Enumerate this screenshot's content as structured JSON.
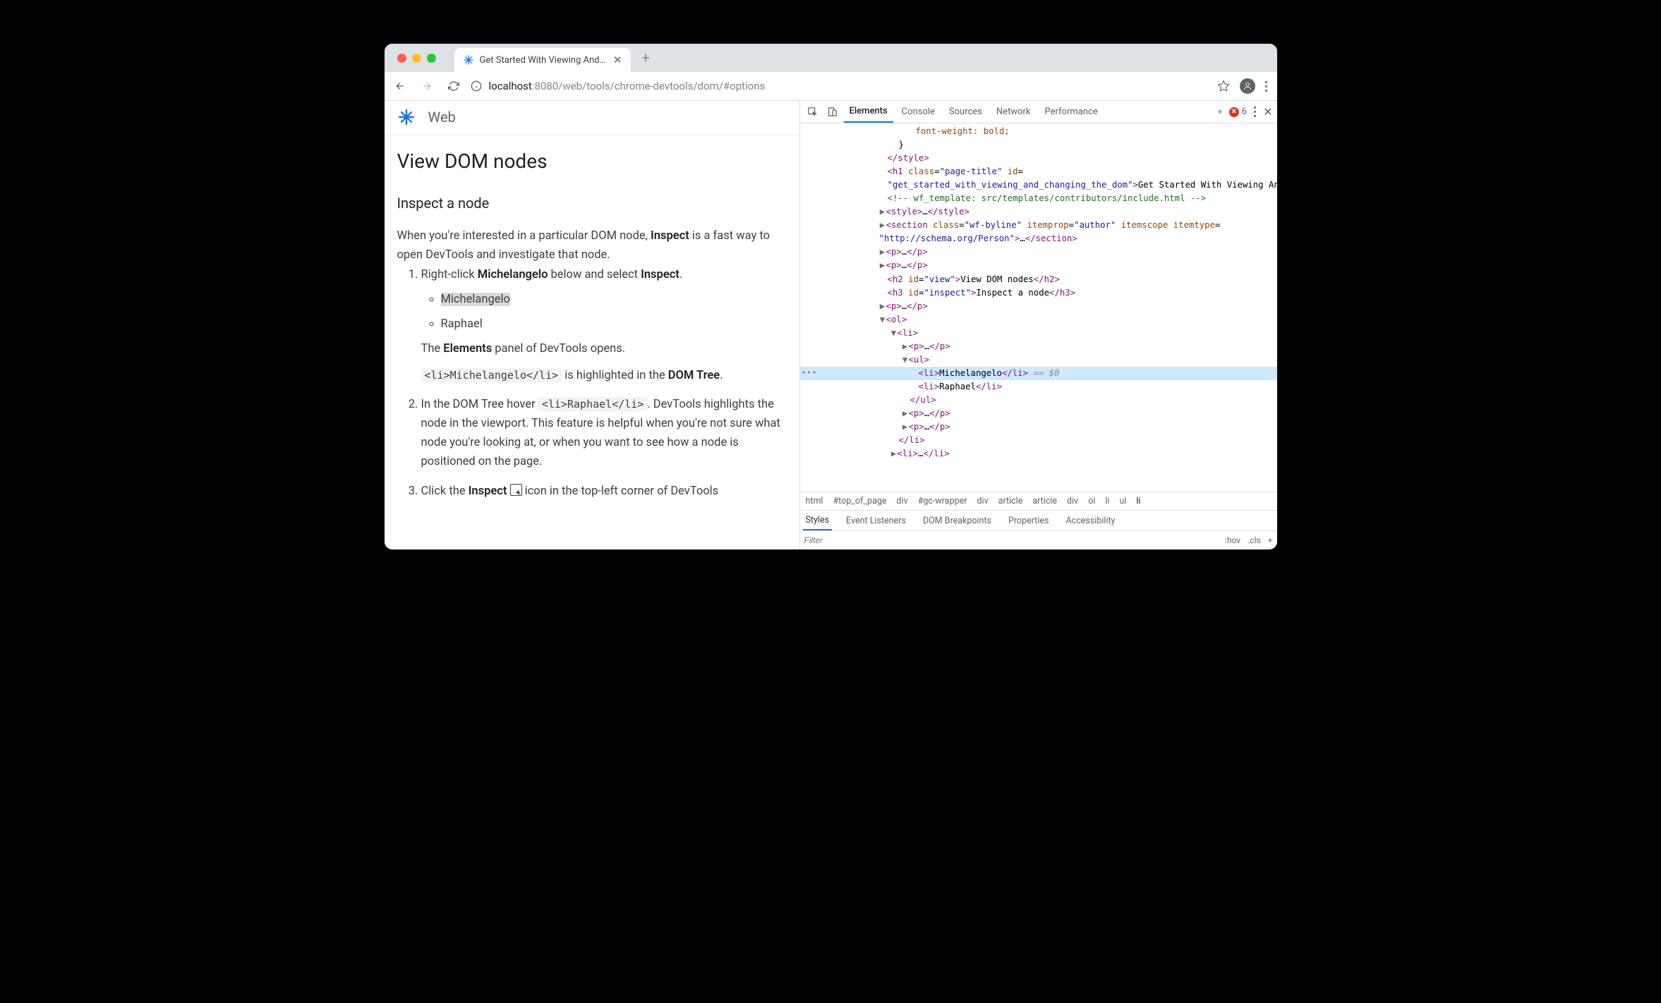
{
  "browser": {
    "tab_title": "Get Started With Viewing And C",
    "url_host": "localhost",
    "url_port": ":8080",
    "url_path": "/web/tools/chrome-devtools/dom/#options"
  },
  "page": {
    "site_label": "Web",
    "h2": "View DOM nodes",
    "h3": "Inspect a node",
    "intro_pre": "When you're interested in a particular DOM node, ",
    "intro_b": "Inspect",
    "intro_post": " is a fast way to open DevTools and investigate that node.",
    "step1_pre": "Right-click ",
    "step1_b": "Michelangelo",
    "step1_mid": " below and select ",
    "step1_b2": "Inspect",
    "step1_post": ".",
    "li_michelangelo": "Michelangelo",
    "li_raphael": "Raphael",
    "elements_sentence_pre": "The ",
    "elements_sentence_b": "Elements",
    "elements_sentence_post": " panel of DevTools opens.",
    "code_li": "<li>Michelangelo</li>",
    "code_li_post_pre": " is highlighted in the ",
    "code_li_post_b": "DOM Tree",
    "code_li_post_post": ".",
    "step2_pre": "In the DOM Tree hover ",
    "step2_code": "<li>Raphael</li>",
    "step2_post": ". DevTools highlights the node in the viewport. This feature is helpful when you're not sure what node you're looking at, or when you want to see how a node is positioned on the page.",
    "step3_pre": "Click the ",
    "step3_b": "Inspect",
    "step3_post": " icon in the top-left corner of DevTools"
  },
  "devtools": {
    "tabs": [
      "Elements",
      "Console",
      "Sources",
      "Network",
      "Performance"
    ],
    "overflow": "»",
    "error_count": "6",
    "breadcrumb": [
      "html",
      "#top_of_page",
      "div",
      "#gc-wrapper",
      "div",
      "article",
      "article",
      "div",
      "ol",
      "li",
      "ul",
      "li"
    ],
    "sub_tabs": [
      "Styles",
      "Event Listeners",
      "DOM Breakpoints",
      "Properties",
      "Accessibility"
    ],
    "filter_placeholder": "Filter",
    "hov": ":hov",
    "cls": ".cls",
    "dom": {
      "l0": "font-weight: bold;",
      "l1": "}",
      "l2": "</style>",
      "h1_class": "page-title",
      "h1_id": "get_started_with_viewing_and_changing_the_dom",
      "h1_text": "Get Started With Viewing And Changing The DOM",
      "comment": "<!-- wf_template: src/templates/contributors/include.html -->",
      "section_class": "wf-byline",
      "section_itemprop": "author",
      "section_itemtype": "http://schema.org/Person",
      "h2_id": "view",
      "h2_text": "View DOM nodes",
      "h3_id": "inspect",
      "h3_text": "Inspect a node",
      "li_m": "Michelangelo",
      "li_r": "Raphael",
      "varref": "== $0"
    }
  }
}
